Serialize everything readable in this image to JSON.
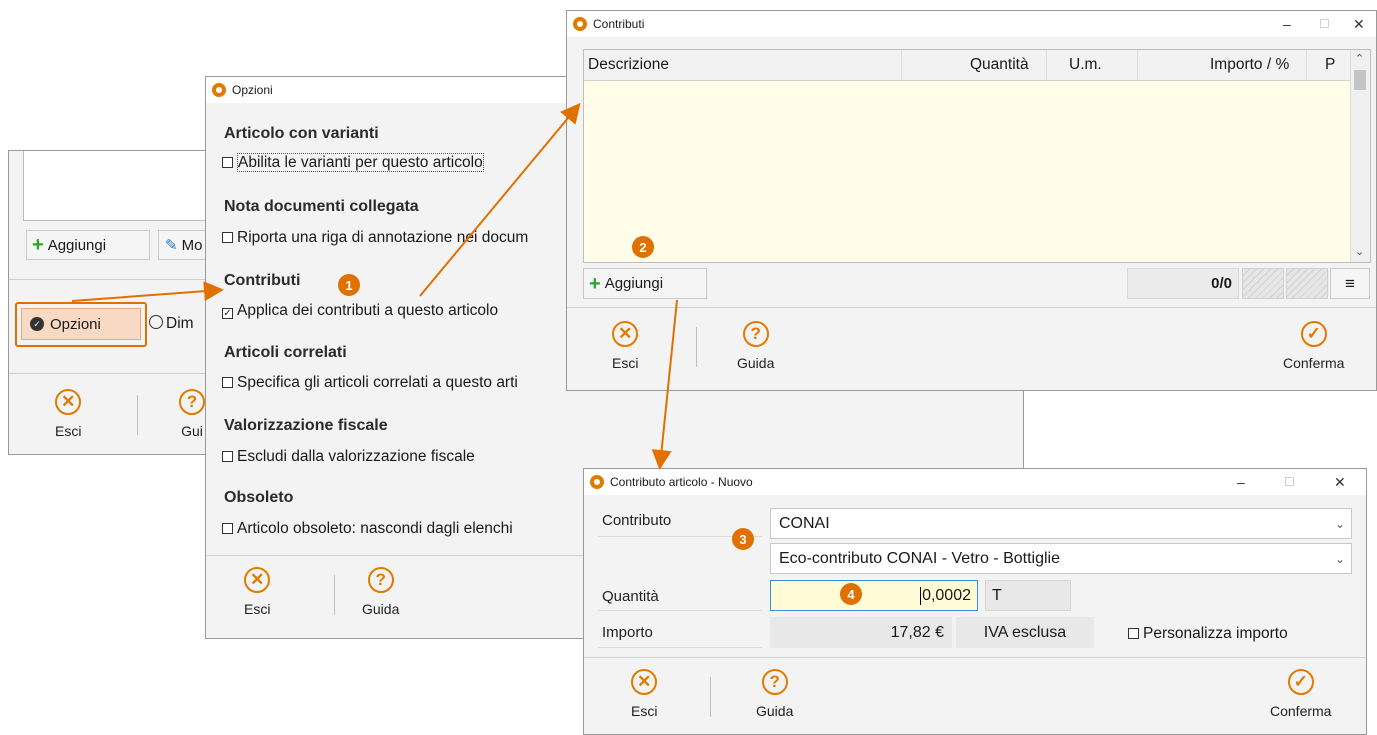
{
  "colors": {
    "accent": "#e07b00",
    "add_green": "#2aa52a",
    "grid_bg": "#fffde8",
    "qty_bg": "#fffbd6"
  },
  "bg_window": {
    "aggiungi": "Aggiungi",
    "modifica": "Mo",
    "opzioni": "Opzioni",
    "dimensioni": "Dim",
    "esci": "Esci",
    "guida": "Gui"
  },
  "opzioni": {
    "title": "Opzioni",
    "sections": [
      {
        "heading": "Articolo con varianti",
        "option": "Abilita le varianti per questo articolo",
        "checked": false
      },
      {
        "heading": "Nota documenti collegata",
        "option": "Riporta una riga di annotazione nei docum",
        "checked": false
      },
      {
        "heading": "Contributi",
        "option": "Applica dei contributi a questo articolo",
        "checked": true
      },
      {
        "heading": "Articoli correlati",
        "option": "Specifica gli articoli correlati a questo arti",
        "checked": false
      },
      {
        "heading": "Valorizzazione fiscale",
        "option": "Escludi dalla valorizzazione fiscale",
        "checked": false
      },
      {
        "heading": "Obsoleto",
        "option": "Articolo obsoleto: nascondi dagli elenchi",
        "checked": false
      }
    ],
    "esci": "Esci",
    "guida": "Guida"
  },
  "contributi": {
    "title": "Contributi",
    "columns": {
      "descrizione": "Descrizione",
      "quantita": "Quantità",
      "um": "U.m.",
      "importo": "Importo / %",
      "p": "P"
    },
    "aggiungi": "Aggiungi",
    "counter": "0/0",
    "esci": "Esci",
    "guida": "Guida",
    "conferma": "Conferma"
  },
  "contributo_articolo": {
    "title": "Contributo articolo - Nuovo",
    "contributo_label": "Contributo",
    "contributo_value": "CONAI",
    "tipo_value": "Eco-contributo CONAI - Vetro - Bottiglie",
    "quantita_label": "Quantità",
    "quantita_value": "0,0002",
    "um_value": "T",
    "importo_label": "Importo",
    "importo_value": "17,82 €",
    "iva_value": "IVA esclusa",
    "personalizza": "Personalizza importo",
    "esci": "Esci",
    "guida": "Guida",
    "conferma": "Conferma"
  },
  "badges": [
    "1",
    "2",
    "3",
    "4"
  ],
  "window_controls": {
    "minimize": "–",
    "maximize": "☐",
    "close": "✕"
  }
}
